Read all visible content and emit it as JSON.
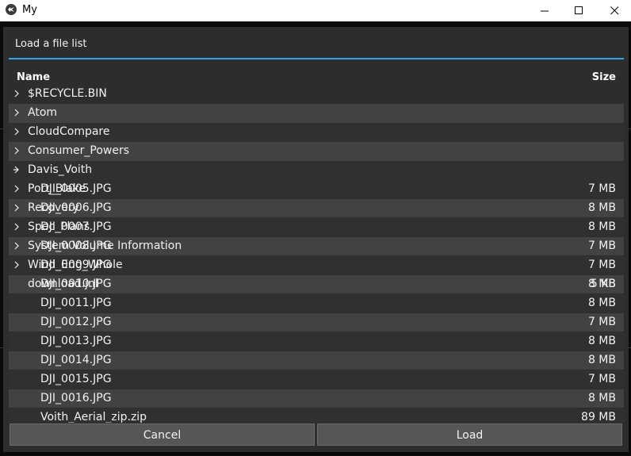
{
  "window": {
    "title": "My",
    "accent": "#33a5e5"
  },
  "dialog": {
    "title": "Load a file list"
  },
  "columns": {
    "name": "Name",
    "size": "Size"
  },
  "files": [
    {
      "name": "DJI_0005.JPG",
      "size": "7 MB"
    },
    {
      "name": "DJI_0006.JPG",
      "size": "8 MB"
    },
    {
      "name": "DJI_0007.JPG",
      "size": "8 MB"
    },
    {
      "name": "DJI_0008.JPG",
      "size": "7 MB"
    },
    {
      "name": "DJI_0009.JPG",
      "size": "7 MB"
    },
    {
      "name": "DJI_0010.JPG",
      "size": "8 MB"
    },
    {
      "name": "DJI_0011.JPG",
      "size": "8 MB"
    },
    {
      "name": "DJI_0012.JPG",
      "size": "7 MB"
    },
    {
      "name": "DJI_0013.JPG",
      "size": "8 MB"
    },
    {
      "name": "DJI_0014.JPG",
      "size": "8 MB"
    },
    {
      "name": "DJI_0015.JPG",
      "size": "7 MB"
    },
    {
      "name": "DJI_0016.JPG",
      "size": "8 MB"
    },
    {
      "name": "Voith_Aerial_zip.zip",
      "size": "89 MB"
    }
  ],
  "folders": [
    {
      "name": "$RECYCLE.BIN",
      "expanded": false
    },
    {
      "name": "Atom",
      "expanded": false
    },
    {
      "name": "CloudCompare",
      "expanded": false
    },
    {
      "name": "Consumer_Powers",
      "expanded": false
    },
    {
      "name": "Davis_Voith",
      "expanded": true
    },
    {
      "name": "Port_Blake",
      "expanded": false
    },
    {
      "name": "Recovery",
      "expanded": false
    },
    {
      "name": "Spec_Plans",
      "expanded": false
    },
    {
      "name": "System Volume Information",
      "expanded": false
    },
    {
      "name": "Wind_Eng_Whole",
      "expanded": false
    },
    {
      "name": "download.jnl",
      "size": "5 KB"
    }
  ],
  "buttons": {
    "cancel": "Cancel",
    "load": "Load"
  }
}
